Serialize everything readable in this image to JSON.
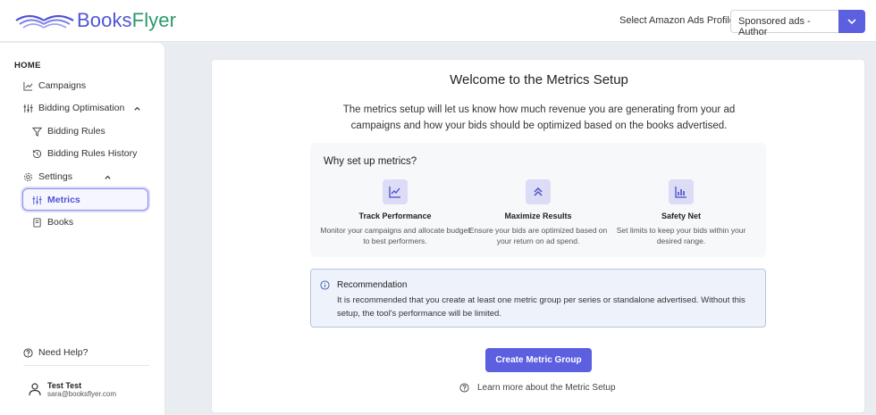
{
  "header": {
    "logo": {
      "books": "Books",
      "flyer": "Flyer"
    },
    "profile_label": "Select Amazon Ads Profile:",
    "profile_value": "Sponsored ads - Author"
  },
  "sidebar": {
    "home": "HOME",
    "campaigns": "Campaigns",
    "bidding_optimisation": "Bidding Optimisation",
    "bidding_rules": "Bidding Rules",
    "bidding_rules_history": "Bidding Rules History",
    "settings": "Settings",
    "metrics": "Metrics",
    "books": "Books",
    "need_help": "Need Help?",
    "user_name": "Test Test",
    "user_email": "sara@booksflyer.com"
  },
  "main": {
    "title": "Welcome to the Metrics Setup",
    "description": "The metrics setup will let us know how much revenue you are generating from your ad campaigns and how your bids should be optimized based on the books advertised.",
    "why_title": "Why set up metrics?",
    "features": [
      {
        "title": "Track Performance",
        "desc": "Monitor your campaigns and allocate budget to best performers.",
        "icon": "chart-line-icon"
      },
      {
        "title": "Maximize Results",
        "desc": "Ensure your bids are optimized based on your return on ad spend.",
        "icon": "chevrons-up-icon"
      },
      {
        "title": "Safety Net",
        "desc": "Set limits to keep your bids within your desired range.",
        "icon": "bar-chart-icon"
      }
    ],
    "recommendation": {
      "title": "Recommendation",
      "text": "It is recommended that you create at least one metric group per series or standalone advertised. Without this setup, the tool's performance will be limited."
    },
    "create_button": "Create Metric Group",
    "learn_more": "Learn more about the Metric Setup"
  },
  "colors": {
    "accent": "#5b5fe0",
    "brand_blue": "#5154d6",
    "brand_green": "#2a9a6a"
  }
}
